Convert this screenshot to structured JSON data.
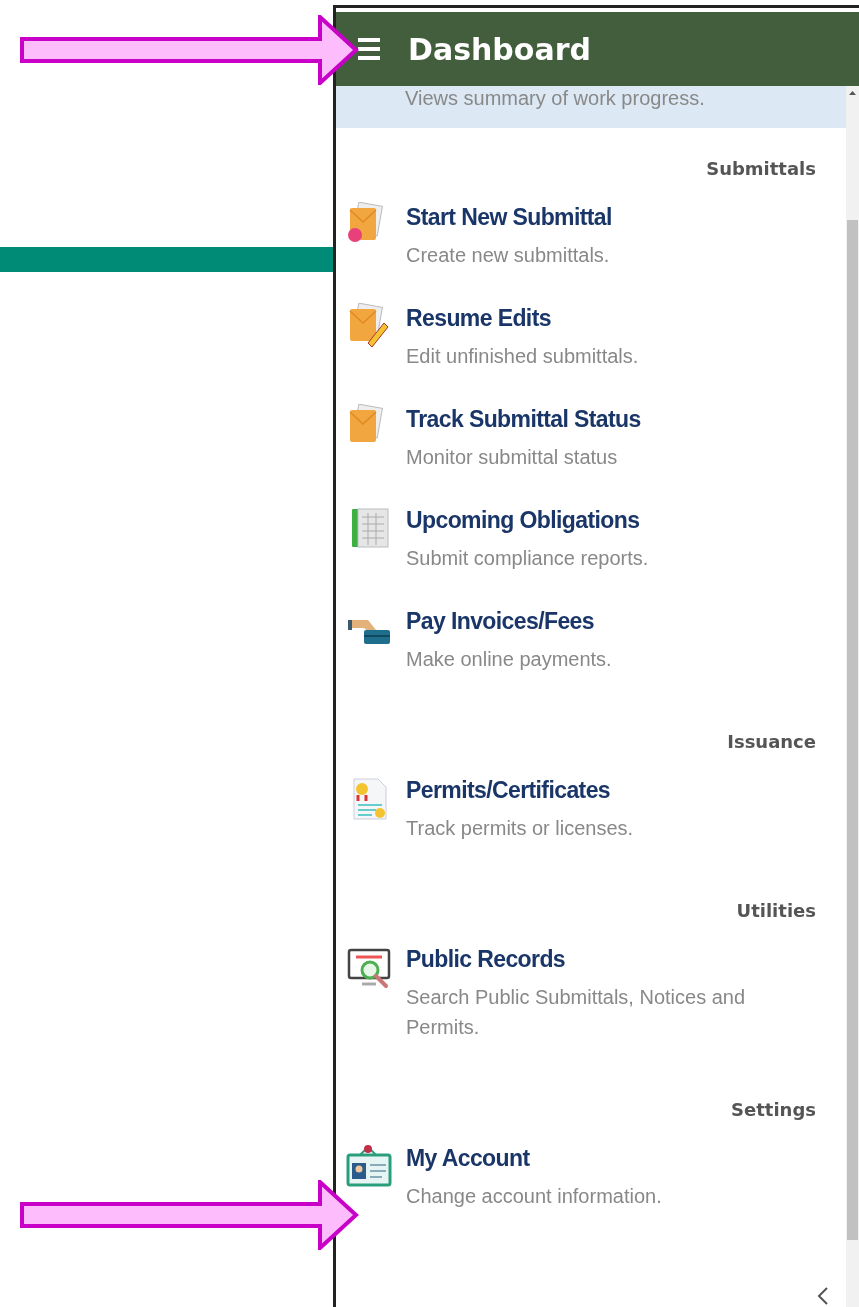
{
  "header": {
    "title": "Dashboard"
  },
  "partial_item": {
    "description": "Views summary of work progress.",
    "selected": true
  },
  "sections": [
    {
      "heading": "Submittals",
      "items": [
        {
          "title": "Start New Submittal",
          "description": "Create new submittals."
        },
        {
          "title": "Resume Edits",
          "description": "Edit unfinished submittals."
        },
        {
          "title": "Track Submittal Status",
          "description": "Monitor submittal status"
        },
        {
          "title": "Upcoming Obligations",
          "description": "Submit compliance reports."
        },
        {
          "title": "Pay Invoices/Fees",
          "description": "Make online payments."
        }
      ]
    },
    {
      "heading": "Issuance",
      "items": [
        {
          "title": "Permits/Certificates",
          "description": "Track permits or licenses."
        }
      ]
    },
    {
      "heading": "Utilities",
      "items": [
        {
          "title": "Public Records",
          "description": "Search Public Submittals, Notices and Permits."
        }
      ]
    },
    {
      "heading": "Settings",
      "items": [
        {
          "title": "My Account",
          "description": "Change account information."
        }
      ]
    }
  ]
}
